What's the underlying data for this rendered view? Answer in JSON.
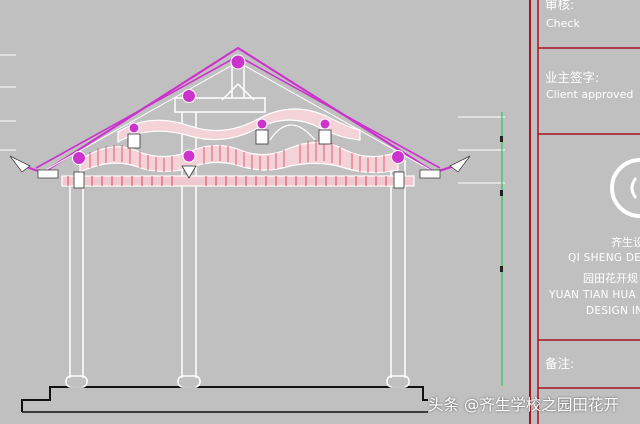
{
  "title_block": {
    "review_label": "审核:",
    "review_en": "Check",
    "client_label": "业主签字:",
    "client_en": "Client approved",
    "company_cn": "齐生设",
    "company_en": "QI SHENG DE",
    "brand_cn": "园田花开规",
    "brand_en_1": "YUAN TIAN HUA H",
    "brand_en_2": "DESIGN IN",
    "remarks_label": "备注:"
  },
  "watermark": "头条 @齐生学校之园田花开",
  "colors": {
    "background": "#c0c0c0",
    "roof": "#cc33cc",
    "structure": "#ffffff",
    "hatch": "#dd2244",
    "titleblock_border": "#aa1122",
    "dimension": "#00cc44"
  }
}
